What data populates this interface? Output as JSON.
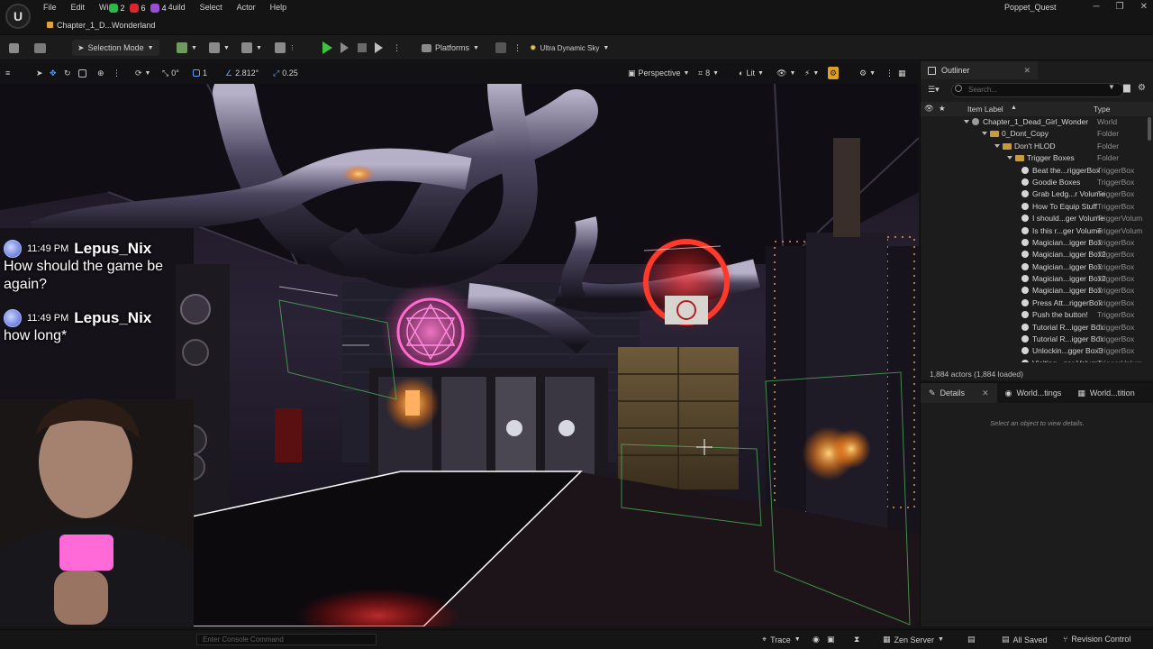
{
  "window": {
    "project_name": "Poppet_Quest",
    "level_tab": "Chapter_1_D...Wonderland",
    "controls": [
      "─",
      "❐",
      "✕"
    ]
  },
  "menu": {
    "items": [
      "File",
      "Edit",
      "Wi",
      "4uild",
      "Select",
      "Actor",
      "Help"
    ],
    "badges": [
      {
        "count": "2",
        "color": "#2fb84a"
      },
      {
        "count": "6",
        "color": "#e0242c"
      },
      {
        "count": "4",
        "color": "#9b4dd6"
      }
    ]
  },
  "toolbar": {
    "selection_mode": "Selection Mode",
    "platforms": "Platforms",
    "sky": "Ultra Dynamic Sky"
  },
  "viewport_toolbar": {
    "rotation_snap": "0°",
    "scale_value": "1",
    "grid_value": "2.812°",
    "scale_snap": "0.25",
    "perspective": "Perspective",
    "camera_speed": "8",
    "lit": "Lit"
  },
  "chat": [
    {
      "time": "11:49 PM",
      "user": "Lepus_Nix",
      "message": "How should the game be again?"
    },
    {
      "time": "11:49 PM",
      "user": "Lepus_Nix",
      "message": "how long*"
    }
  ],
  "outliner": {
    "tab_label": "Outliner",
    "search_placeholder": "Search...",
    "col_label": "Item Label",
    "col_type": "Type",
    "footer": "1,884 actors (1,884 loaded)",
    "rows": [
      {
        "label": "Chapter_1_Dead_Girl_Wonder",
        "type": "World"
      },
      {
        "label": "0_Dont_Copy",
        "type": "Folder"
      },
      {
        "label": "Don't HLOD",
        "type": "Folder"
      },
      {
        "label": "Trigger Boxes",
        "type": "Folder"
      },
      {
        "label": "Beat the...riggerBox",
        "type": "TriggerBox"
      },
      {
        "label": "Goodie Boxes",
        "type": "TriggerBox"
      },
      {
        "label": "Grab Ledg...r Volume",
        "type": "TriggerBox"
      },
      {
        "label": "How To Equip Stuff",
        "type": "TriggerBox"
      },
      {
        "label": "I should...ger Volume",
        "type": "TriggerVolum"
      },
      {
        "label": "Is this r...ger Volume",
        "type": "TriggerVolum"
      },
      {
        "label": "Magician...igger Box",
        "type": "TriggerBox"
      },
      {
        "label": "Magician...igger Box2",
        "type": "TriggerBox"
      },
      {
        "label": "Magician...igger Box",
        "type": "TriggerBox"
      },
      {
        "label": "Magician...igger Box2",
        "type": "TriggerBox"
      },
      {
        "label": "Magician...igger Box",
        "type": "TriggerBox"
      },
      {
        "label": "Press Att...riggerBox",
        "type": "TriggerBox"
      },
      {
        "label": "Push the button!",
        "type": "TriggerBox"
      },
      {
        "label": "Tutorial R...igger Box",
        "type": "TriggerBox"
      },
      {
        "label": "Tutorial R...igger Box",
        "type": "TriggerBox"
      },
      {
        "label": "Unlockin...gger Box3",
        "type": "TriggerBox"
      },
      {
        "label": "Visiting...ger Volume",
        "type": "TriggerVolum"
      }
    ]
  },
  "details": {
    "tabs": [
      "Details",
      "World...tings",
      "World...tition"
    ],
    "empty_message": "Select an object to view details."
  },
  "statusbar": {
    "console_placeholder": "Enter Console Command",
    "trace": "Trace",
    "zen_server": "Zen Server",
    "all_saved": "All Saved",
    "revision_control": "Revision Control"
  }
}
